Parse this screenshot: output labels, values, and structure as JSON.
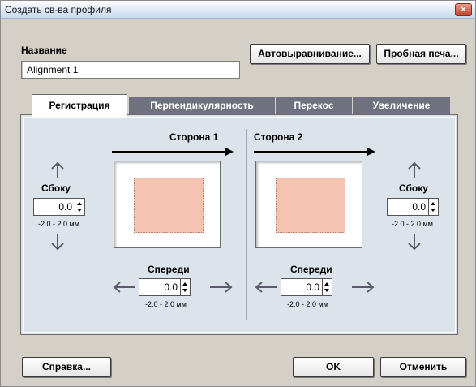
{
  "window": {
    "title": "Создать св-ва профиля",
    "close_label": "×"
  },
  "name": {
    "label": "Название",
    "value": "Alignment 1"
  },
  "toolbar": {
    "auto_align_label": "Автовыравнивание...",
    "test_print_label": "Пробная печа..."
  },
  "tabs": [
    {
      "label": "Регистрация",
      "active": true
    },
    {
      "label": "Перпендикулярность",
      "active": false
    },
    {
      "label": "Перекос",
      "active": false
    },
    {
      "label": "Увеличение",
      "active": false
    }
  ],
  "side1": {
    "title": "Сторона 1",
    "side_label": "Сбоку",
    "side_value": "0.0",
    "side_range": "-2.0 - 2.0 мм",
    "front_label": "Спереди",
    "front_value": "0.0",
    "front_range": "-2.0 - 2.0 мм"
  },
  "side2": {
    "title": "Сторона 2",
    "side_label": "Сбоку",
    "side_value": "0.0",
    "side_range": "-2.0 - 2.0 мм",
    "front_label": "Спереди",
    "front_value": "0.0",
    "front_range": "-2.0 - 2.0 мм"
  },
  "footer": {
    "help_label": "Справка...",
    "ok_label": "OK",
    "cancel_label": "Отменить"
  },
  "colors": {
    "inactive_tab": "#6f7180",
    "panel": "#dde3ea",
    "image_fill": "#f5c3b2"
  }
}
